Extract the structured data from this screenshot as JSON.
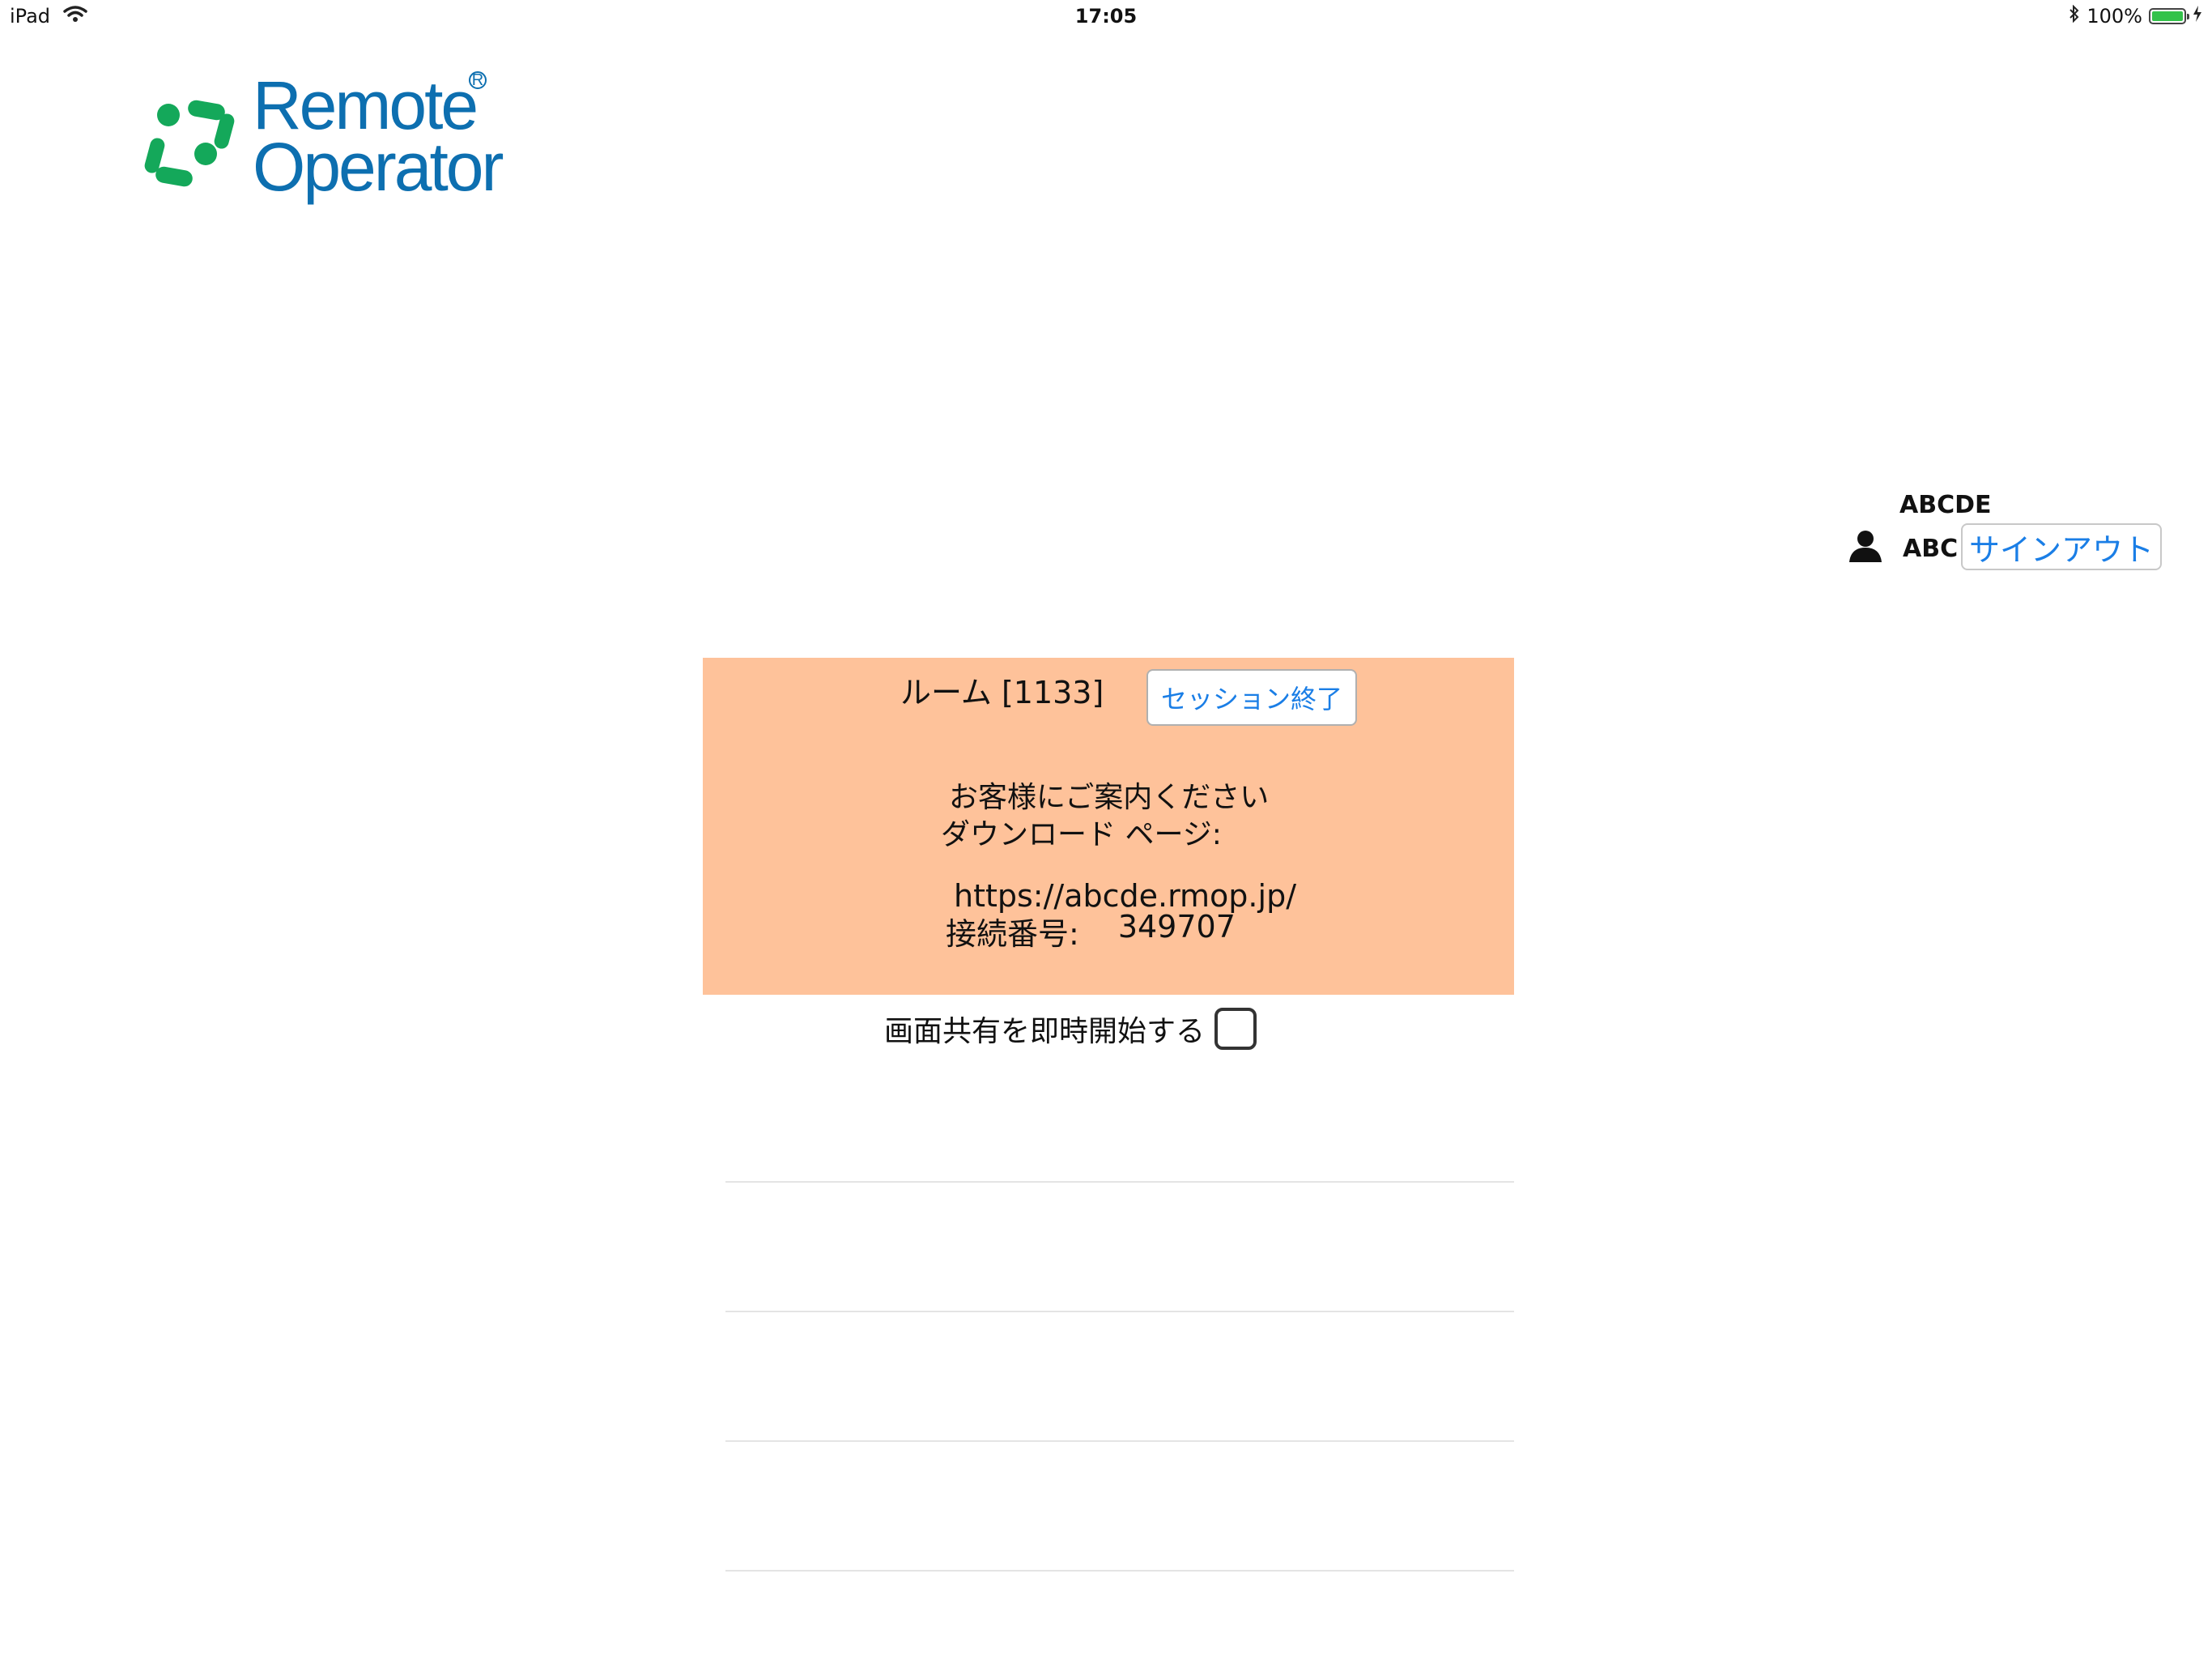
{
  "status_bar": {
    "device": "iPad",
    "time": "17:05",
    "battery_text": "100%",
    "battery_level": 1.0,
    "battery_color": "#33c24a"
  },
  "logo": {
    "line1": "Remote",
    "line2": "Operator",
    "reg": "R",
    "brand_blue": "#0d6fb0",
    "brand_green": "#14a85a"
  },
  "user": {
    "company": "ABCDE",
    "name": "ABC",
    "signout_label": "サインアウト",
    "icon": "person-icon"
  },
  "room": {
    "title": "ルーム [1133]",
    "end_session_label": "セッション終了",
    "guide_line1": "お客様にご案内ください",
    "guide_line2": "ダウンロード ページ:",
    "url": "https://abcde.rmop.jp/",
    "connection_label": "接続番号:",
    "connection_number": "349707",
    "background": "#fec29a"
  },
  "share": {
    "label": "画面共有を即時開始する",
    "checked": false
  },
  "colors": {
    "link_blue": "#1a7ee6"
  }
}
